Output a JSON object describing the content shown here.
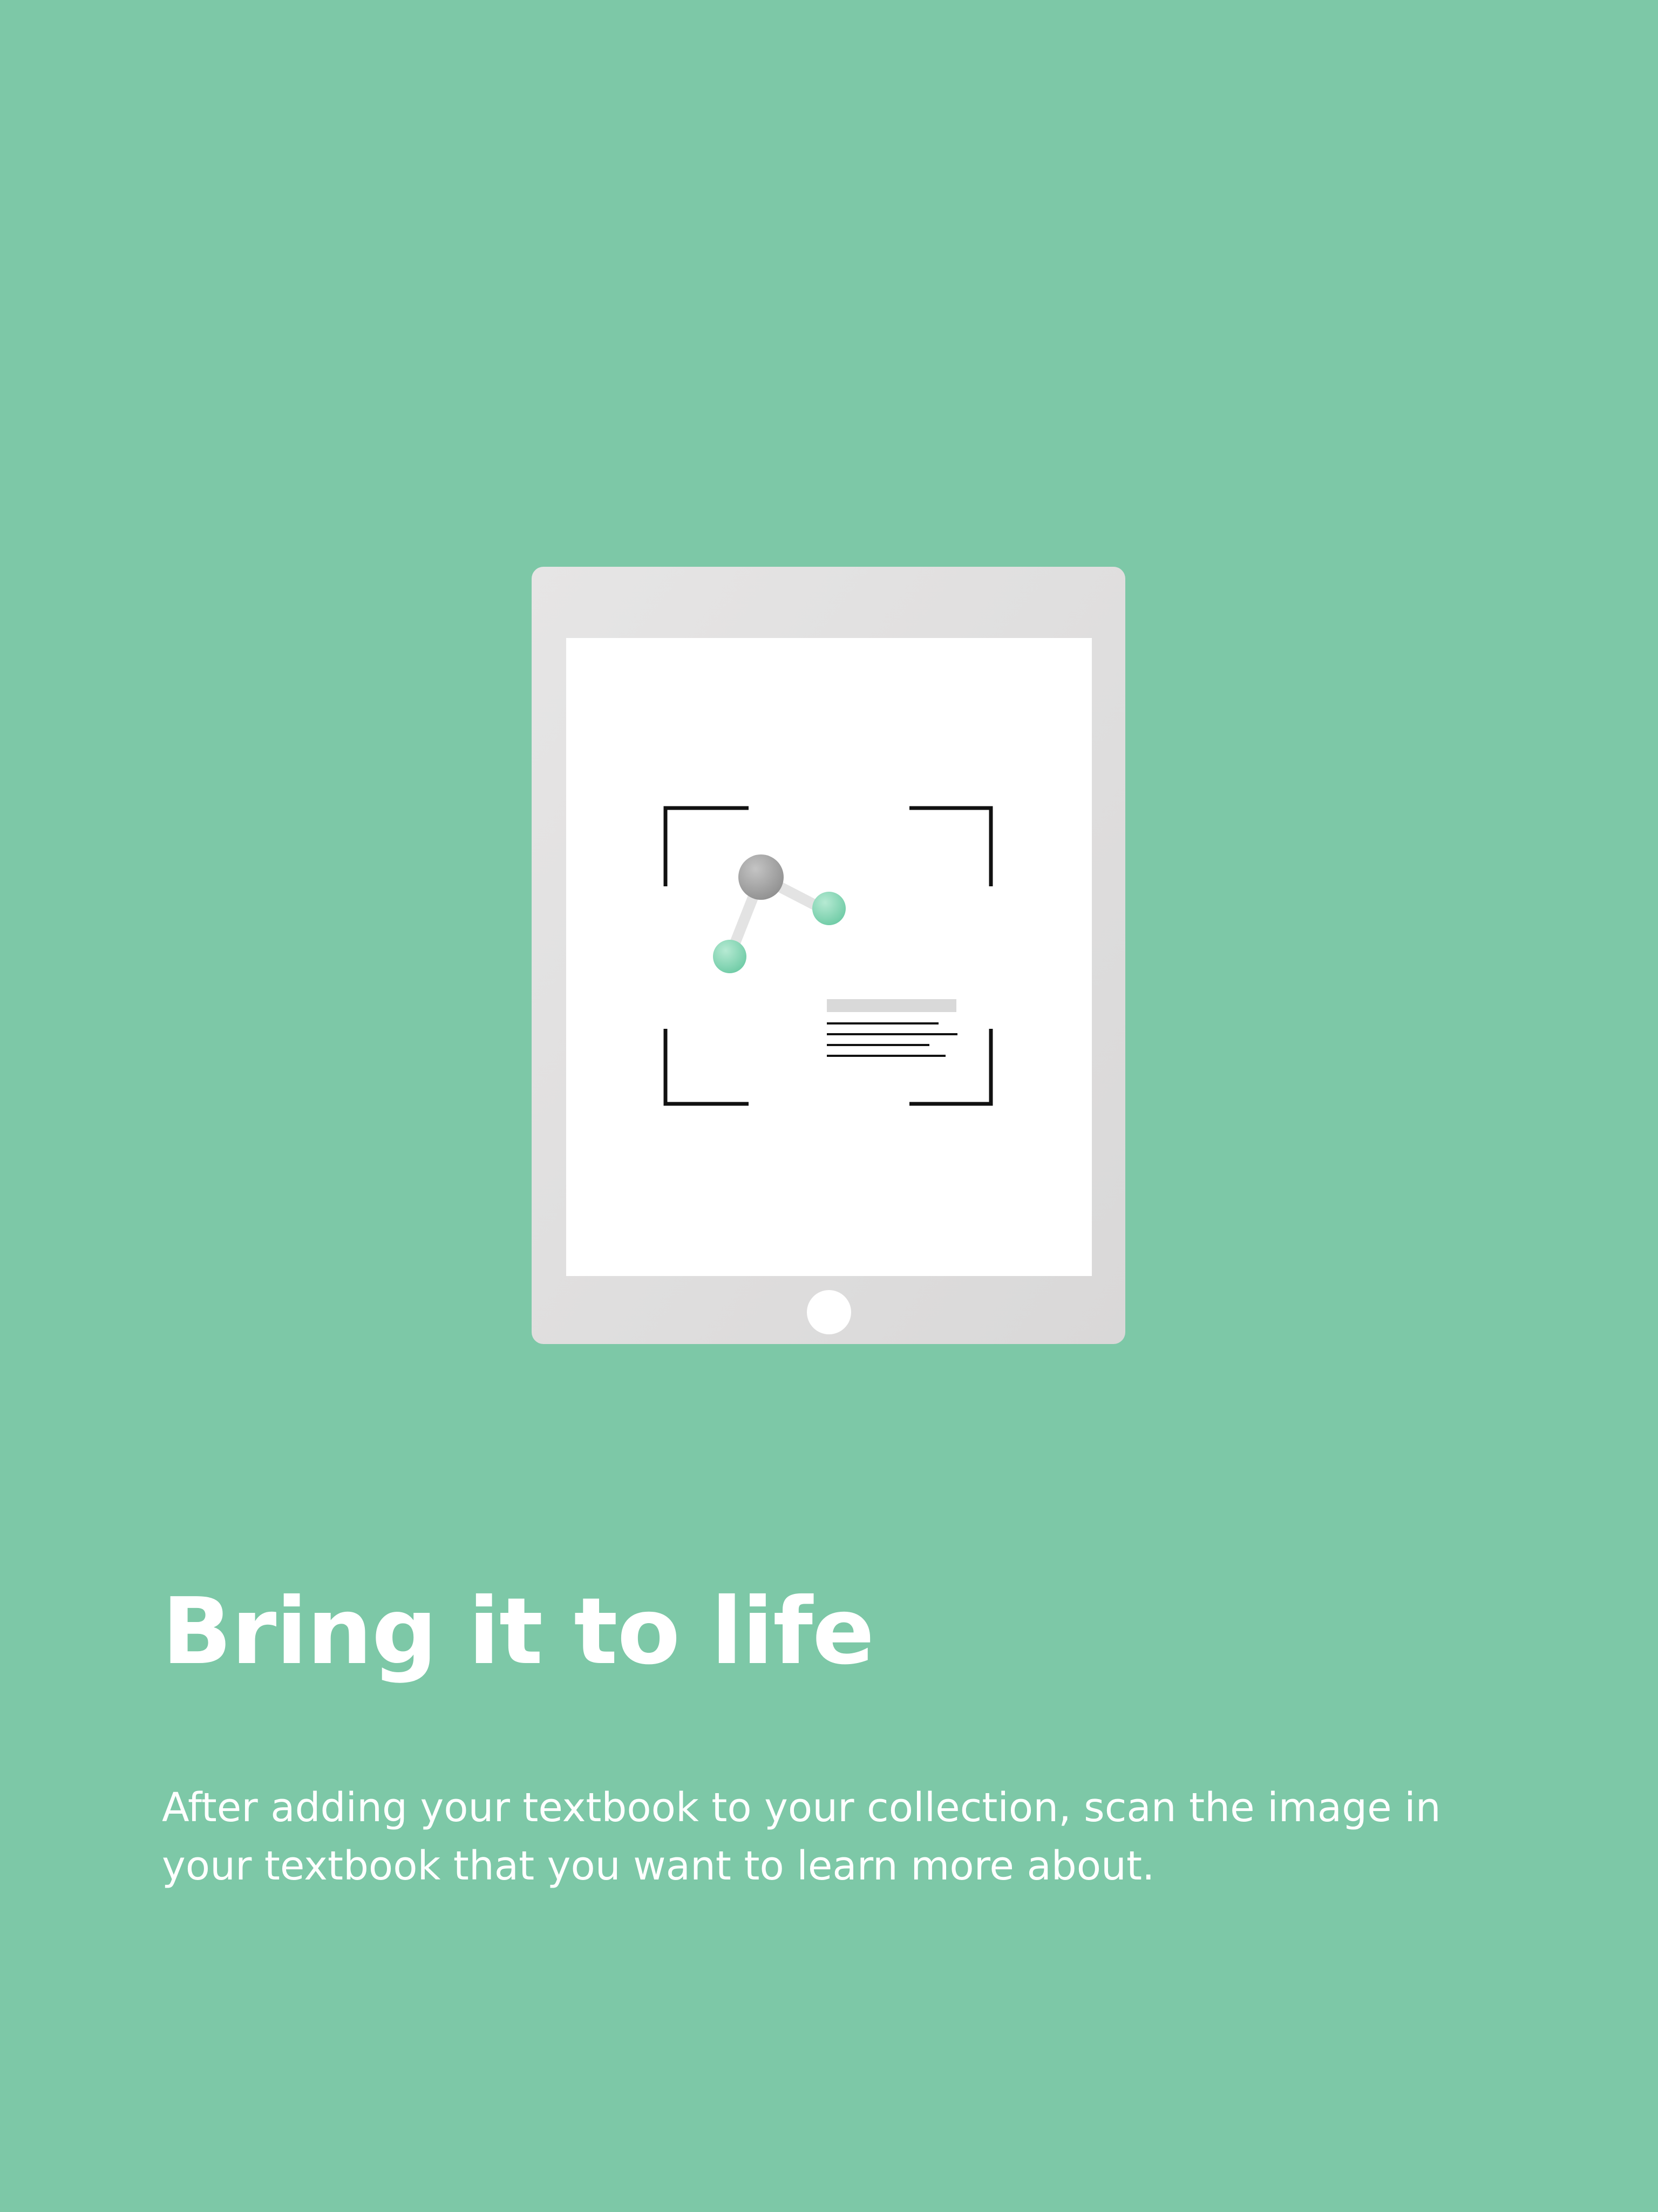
{
  "screen": {
    "background_color": "#7dc8a7"
  },
  "illustration": {
    "icon": "tablet-scan-icon",
    "tablet_frame_color": "#e0dfdf",
    "screen_color": "#ffffff",
    "accent_color": "#8fd6b8",
    "scan_bracket_color": "#111111"
  },
  "content": {
    "title": "Bring it to life",
    "description": "After adding your textbook to your collection, scan the image in your textbook that you want to learn more about."
  }
}
